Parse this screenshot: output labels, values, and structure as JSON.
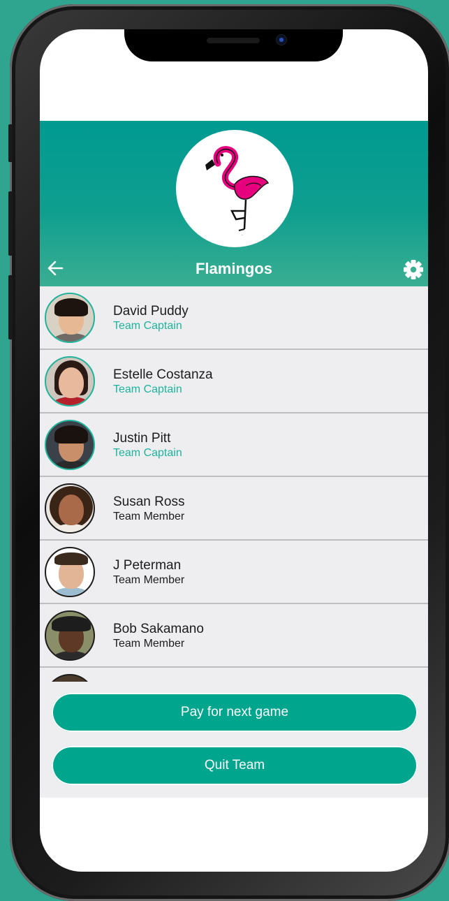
{
  "team": {
    "title": "Flamingos",
    "logo": "flamingo-logo"
  },
  "header": {
    "back_icon": "arrow-left-icon",
    "settings_icon": "gear-icon"
  },
  "colors": {
    "accent": "#00a58d",
    "captain_role": "#1fb39c",
    "member_role": "#1c1c1c",
    "list_bg": "#eeeef1"
  },
  "members": [
    {
      "name": "David Puddy",
      "role": "Team Captain"
    },
    {
      "name": "Estelle Costanza",
      "role": "Team Captain"
    },
    {
      "name": "Justin Pitt",
      "role": "Team Captain"
    },
    {
      "name": "Susan Ross",
      "role": "Team Member"
    },
    {
      "name": "J Peterman",
      "role": "Team Member"
    },
    {
      "name": "Bob Sakamano",
      "role": "Team Member"
    }
  ],
  "actions": {
    "pay_label": "Pay for next game",
    "quit_label": "Quit Team"
  }
}
